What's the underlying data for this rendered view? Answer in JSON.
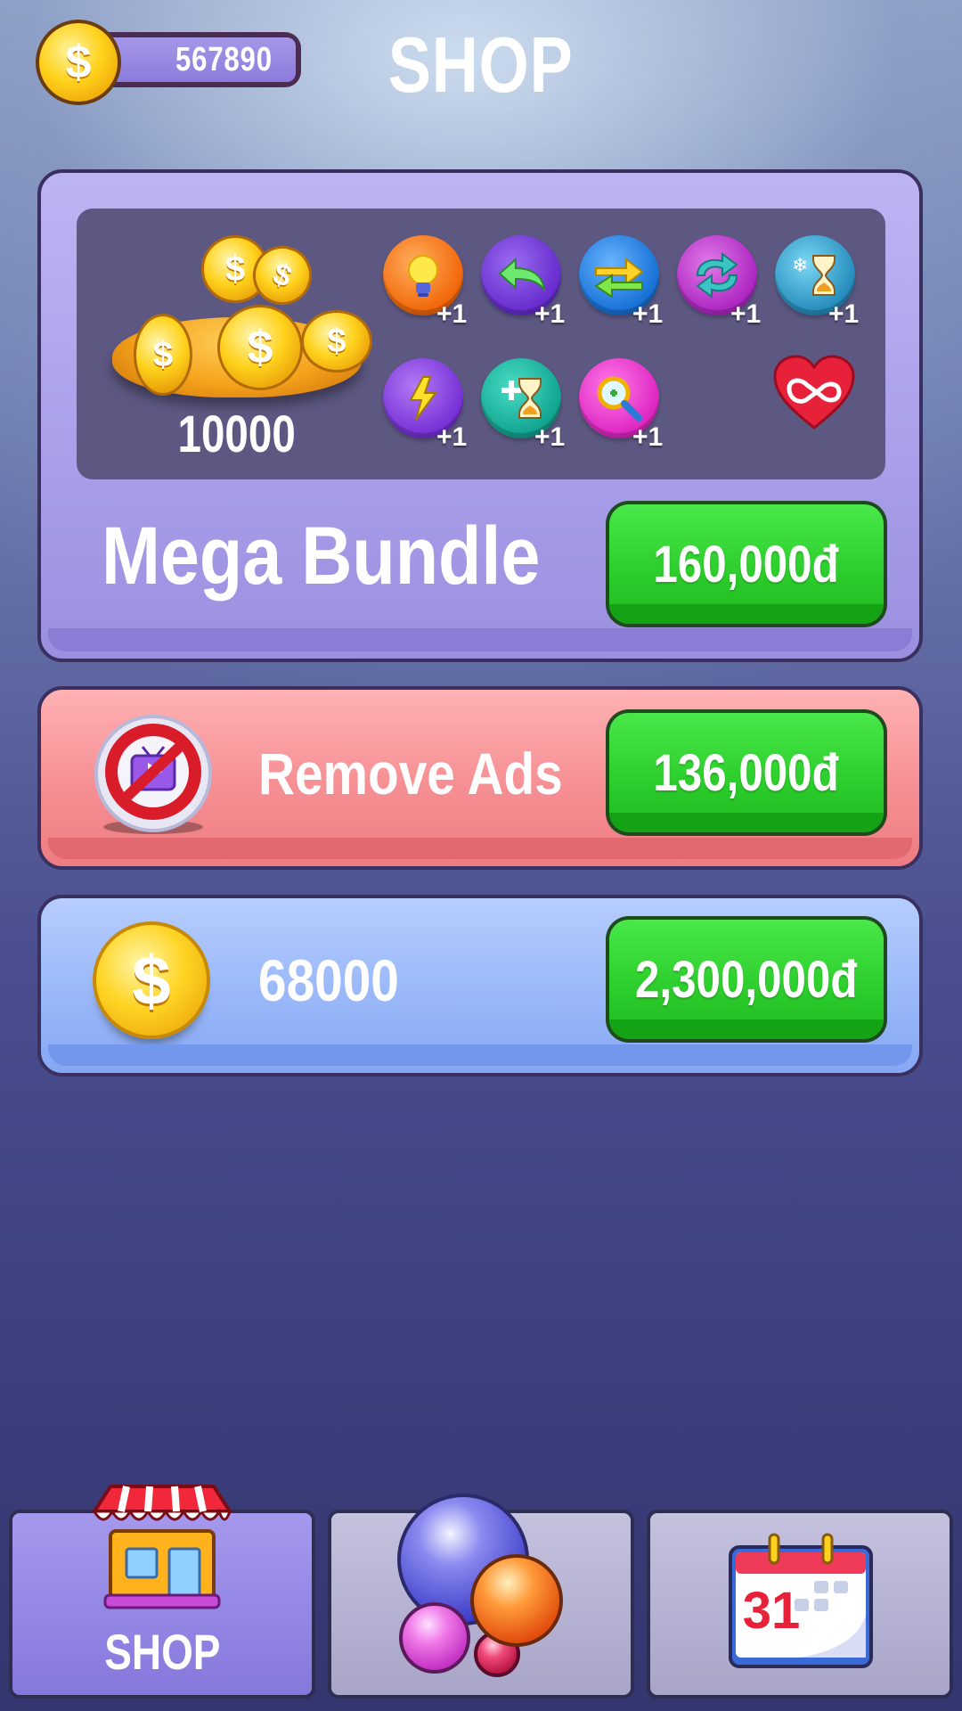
{
  "header": {
    "coin_balance": "567890",
    "title": "SHOP"
  },
  "mega_bundle": {
    "coin_amount": "10000",
    "title": "Mega Bundle",
    "price": "160,000đ",
    "powerups": [
      {
        "icon": "lightbulb-icon",
        "qty": "+1"
      },
      {
        "icon": "undo-arrow-icon",
        "qty": "+1"
      },
      {
        "icon": "shuffle-arrows-icon",
        "qty": "+1"
      },
      {
        "icon": "refresh-arrows-icon",
        "qty": "+1"
      },
      {
        "icon": "freeze-time-icon",
        "qty": "+1"
      },
      {
        "icon": "lightning-icon",
        "qty": "+1"
      },
      {
        "icon": "add-time-icon",
        "qty": "+1"
      },
      {
        "icon": "magnifier-icon",
        "qty": "+1"
      }
    ],
    "extra_icon": "infinite-lives-heart-icon"
  },
  "remove_ads": {
    "label": "Remove Ads",
    "price": "136,000đ"
  },
  "coin_pack": {
    "amount": "68000",
    "price": "2,300,000đ"
  },
  "nav": {
    "tabs": [
      {
        "label": "SHOP",
        "icon": "shop-stall-icon",
        "active": true
      },
      {
        "label": "",
        "icon": "bubbles-icon",
        "active": false
      },
      {
        "label": "",
        "icon": "calendar-icon",
        "active": false
      }
    ],
    "calendar_day": "31"
  },
  "colors": {
    "buy_button": "#2fd12f",
    "mega_card": "#a99ee9",
    "ads_card": "#f58f93",
    "coins_card": "#9ab8f9"
  }
}
